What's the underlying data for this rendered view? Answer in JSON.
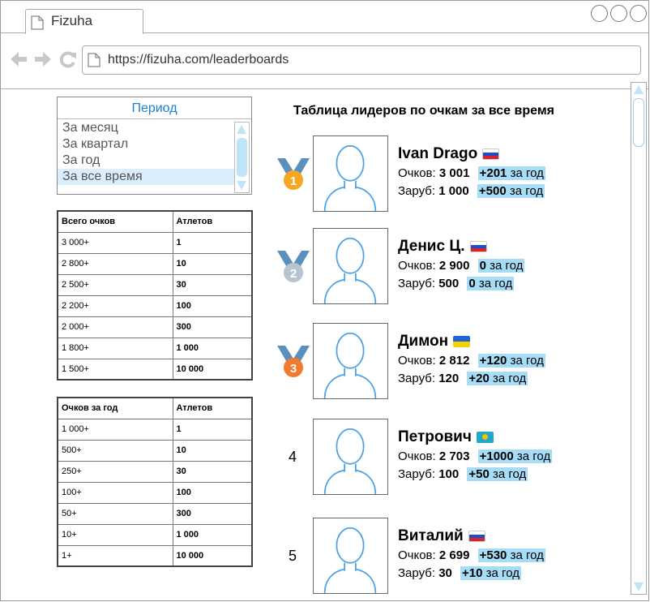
{
  "browser": {
    "tab_title": "Fizuha",
    "url": "https://fizuha.com/leaderboards"
  },
  "period": {
    "header": "Период",
    "options": [
      "За месяц",
      "За квартал",
      "За год",
      "За все время"
    ],
    "selected": "За все время"
  },
  "table_total": {
    "headers": [
      "Всего очков",
      "Атлетов"
    ],
    "rows": [
      [
        "3 000+",
        "1"
      ],
      [
        "2 800+",
        "10"
      ],
      [
        "2 500+",
        "30"
      ],
      [
        "2 200+",
        "100"
      ],
      [
        "2 000+",
        "300"
      ],
      [
        "1 800+",
        "1 000"
      ],
      [
        "1 500+",
        "10 000"
      ]
    ]
  },
  "table_year": {
    "headers": [
      "Очков за год",
      "Атлетов"
    ],
    "rows": [
      [
        "1 000+",
        "1"
      ],
      [
        "500+",
        "10"
      ],
      [
        "250+",
        "30"
      ],
      [
        "100+",
        "100"
      ],
      [
        "50+",
        "300"
      ],
      [
        "10+",
        "1 000"
      ],
      [
        "1+",
        "10 000"
      ]
    ]
  },
  "leaderboard": {
    "title": "Таблица лидеров по очкам за все время",
    "points_label": "Очков:",
    "kills_label": "Заруб:",
    "period_suffix": "за год",
    "colors": {
      "gold": "#f5a623",
      "silver": "#b8c4cf",
      "bronze": "#f07b2c",
      "highlight": "#a7dcf6",
      "ribbon": "#5b8fbd"
    },
    "entries": [
      {
        "rank": "1",
        "name": "Ivan Drago",
        "flag": "ru",
        "points": "3 001",
        "points_delta": "+201",
        "kills": "1 000",
        "kills_delta": "+500"
      },
      {
        "rank": "2",
        "name": "Денис Ц.",
        "flag": "ru",
        "points": "2 900",
        "points_delta": "0",
        "kills": "500",
        "kills_delta": "0"
      },
      {
        "rank": "3",
        "name": "Димон",
        "flag": "ua",
        "points": "2 812",
        "points_delta": "+120",
        "kills": "120",
        "kills_delta": "+20"
      },
      {
        "rank": "4",
        "name": "Петрович",
        "flag": "kz",
        "points": "2 703",
        "points_delta": "+1000",
        "kills": "100",
        "kills_delta": "+50"
      },
      {
        "rank": "5",
        "name": "Виталий",
        "flag": "ru",
        "points": "2 699",
        "points_delta": "+530",
        "kills": "30",
        "kills_delta": "+10"
      }
    ]
  }
}
